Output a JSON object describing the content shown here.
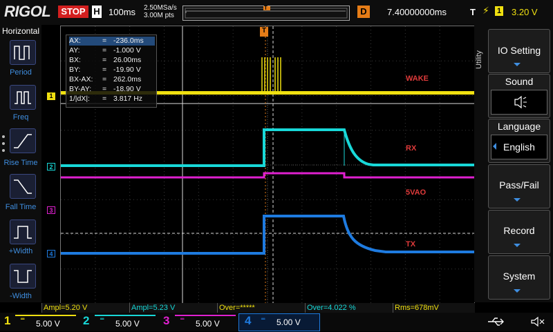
{
  "topbar": {
    "brand": "RIGOL",
    "run_state": "STOP",
    "timebase_label": "H",
    "timebase_value": "100ms",
    "sample_rate": "2.50MSa/s",
    "memory_depth": "3.00M pts",
    "trigger_marker": "T",
    "delay_label": "D",
    "delay_value": "7.40000000ms",
    "trigger_label": "T",
    "trigger_edge": "rising-edge-icon",
    "trigger_source": "1",
    "trigger_level": "3.20 V"
  },
  "left_menu": {
    "header": "Horizontal",
    "items": [
      {
        "label": "Period",
        "icon": "period-measure-icon"
      },
      {
        "label": "Freq",
        "icon": "frequency-measure-icon"
      },
      {
        "label": "Rise Time",
        "icon": "rise-time-icon"
      },
      {
        "label": "Fall Time",
        "icon": "fall-time-icon"
      },
      {
        "label": "+Width",
        "icon": "positive-width-icon"
      },
      {
        "label": "-Width",
        "icon": "negative-width-icon"
      }
    ]
  },
  "right_menu": {
    "side_label": "Utility",
    "items": [
      {
        "label": "IO Setting"
      },
      {
        "label": "Sound",
        "icon": "speaker-icon"
      },
      {
        "label": "Language",
        "value": "English"
      },
      {
        "label": "Pass/Fail"
      },
      {
        "label": "Record"
      },
      {
        "label": "System"
      }
    ]
  },
  "cursor_table": {
    "rows": [
      {
        "label": "AX:",
        "eq": "=",
        "value": "-236.0ms"
      },
      {
        "label": "AY:",
        "eq": "=",
        "value": "-1.000 V"
      },
      {
        "label": "BX:",
        "eq": "=",
        "value": "26.00ms"
      },
      {
        "label": "BY:",
        "eq": "=",
        "value": "-19.90 V"
      },
      {
        "label": "BX-AX:",
        "eq": "=",
        "value": "262.0ms"
      },
      {
        "label": "BY-AY:",
        "eq": "=",
        "value": "-18.90 V"
      },
      {
        "label": "1/|dX|:",
        "eq": "=",
        "value": "3.817 Hz"
      }
    ]
  },
  "waveform_labels": {
    "ch1": "WAKE",
    "ch2": "RX",
    "ch3": "5VAO",
    "ch4": "TX",
    "color": "#e03b3b"
  },
  "channel_markers": [
    "1",
    "2",
    "3",
    "4"
  ],
  "measurements": [
    {
      "text": "Ampl=5.20 V"
    },
    {
      "text": "Ampl=5.23 V"
    },
    {
      "text": "Over=*****"
    },
    {
      "text": "Over=4.022 %"
    },
    {
      "text": "Rms=678mV"
    }
  ],
  "channels": [
    {
      "num": "1",
      "scale": "5.00 V",
      "color": "#f0e010"
    },
    {
      "num": "2",
      "scale": "5.00 V",
      "color": "#18d8d8"
    },
    {
      "num": "3",
      "scale": "5.00 V",
      "color": "#e020d0"
    },
    {
      "num": "4",
      "scale": "5.00 V",
      "color": "#1e7be0"
    }
  ],
  "status_icons": [
    "usb-icon",
    "speaker-muted-icon"
  ],
  "colors": {
    "ch1": "#f0e010",
    "ch2": "#18d8d8",
    "ch3": "#e020d0",
    "ch4": "#1e7be0",
    "stop": "#d31f1f",
    "delay": "#e57c17",
    "accent": "#3f8ee0"
  }
}
